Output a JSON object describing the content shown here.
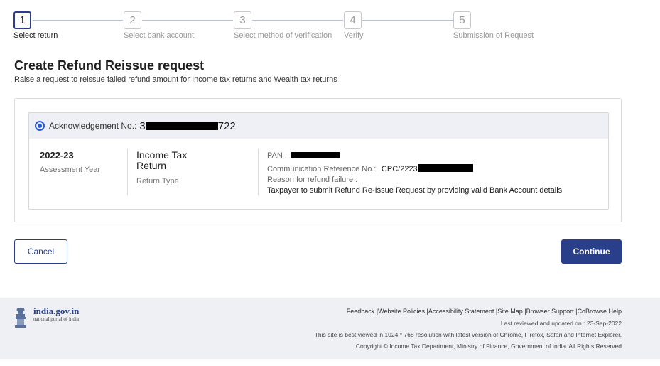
{
  "stepper": {
    "steps": [
      {
        "number": "1",
        "label": "Select return"
      },
      {
        "number": "2",
        "label": "Select bank account"
      },
      {
        "number": "3",
        "label": "Select method of verification"
      },
      {
        "number": "4",
        "label": "Verify"
      },
      {
        "number": "5",
        "label": "Submission of Request"
      }
    ],
    "active_step": 1
  },
  "page": {
    "title": "Create Refund Reissue request",
    "subtitle": "Raise a request to reissue failed refund amount for Income tax returns and Wealth tax returns"
  },
  "return_card": {
    "selected": true,
    "ack_label": "Acknowledgement No.:",
    "ack_value_visible_start": "3",
    "ack_value_visible_end": "722",
    "assessment_year": "2022-23",
    "assessment_year_label": "Assessment Year",
    "return_type": "Income Tax Return",
    "return_type_label": "Return Type",
    "pan_label": "PAN :",
    "comm_ref_label": "Communication Reference No.:",
    "comm_ref_visible": "CPC/2223",
    "reason_label": "Reason for refund failure :",
    "reason_value": "Taxpayer to submit Refund Re-Issue Request by providing valid Bank Account details"
  },
  "actions": {
    "cancel_label": "Cancel",
    "continue_label": "Continue"
  },
  "footer": {
    "logo_title": "india.gov.in",
    "logo_subtitle": "national portal of india",
    "links": [
      "Feedback",
      "Website Policies",
      "Accessibility Statement",
      "Site Map",
      "Browser Support",
      "CoBrowse Help"
    ],
    "last_reviewed": "Last reviewed and updated on : 23-Sep-2022",
    "best_viewed": "This site is best viewed in 1024 * 768 resolution with latest version of Chrome, Firefox, Safari and Internet Explorer.",
    "copyright": "Copyright © Income Tax Department, Ministry of Finance, Government of India. All Rights Reserved"
  },
  "colors": {
    "primary": "#2a3f8a",
    "radio": "#2a5bd7",
    "card_header_bg": "#eef0f5",
    "footer_bg": "#eef0f4"
  }
}
